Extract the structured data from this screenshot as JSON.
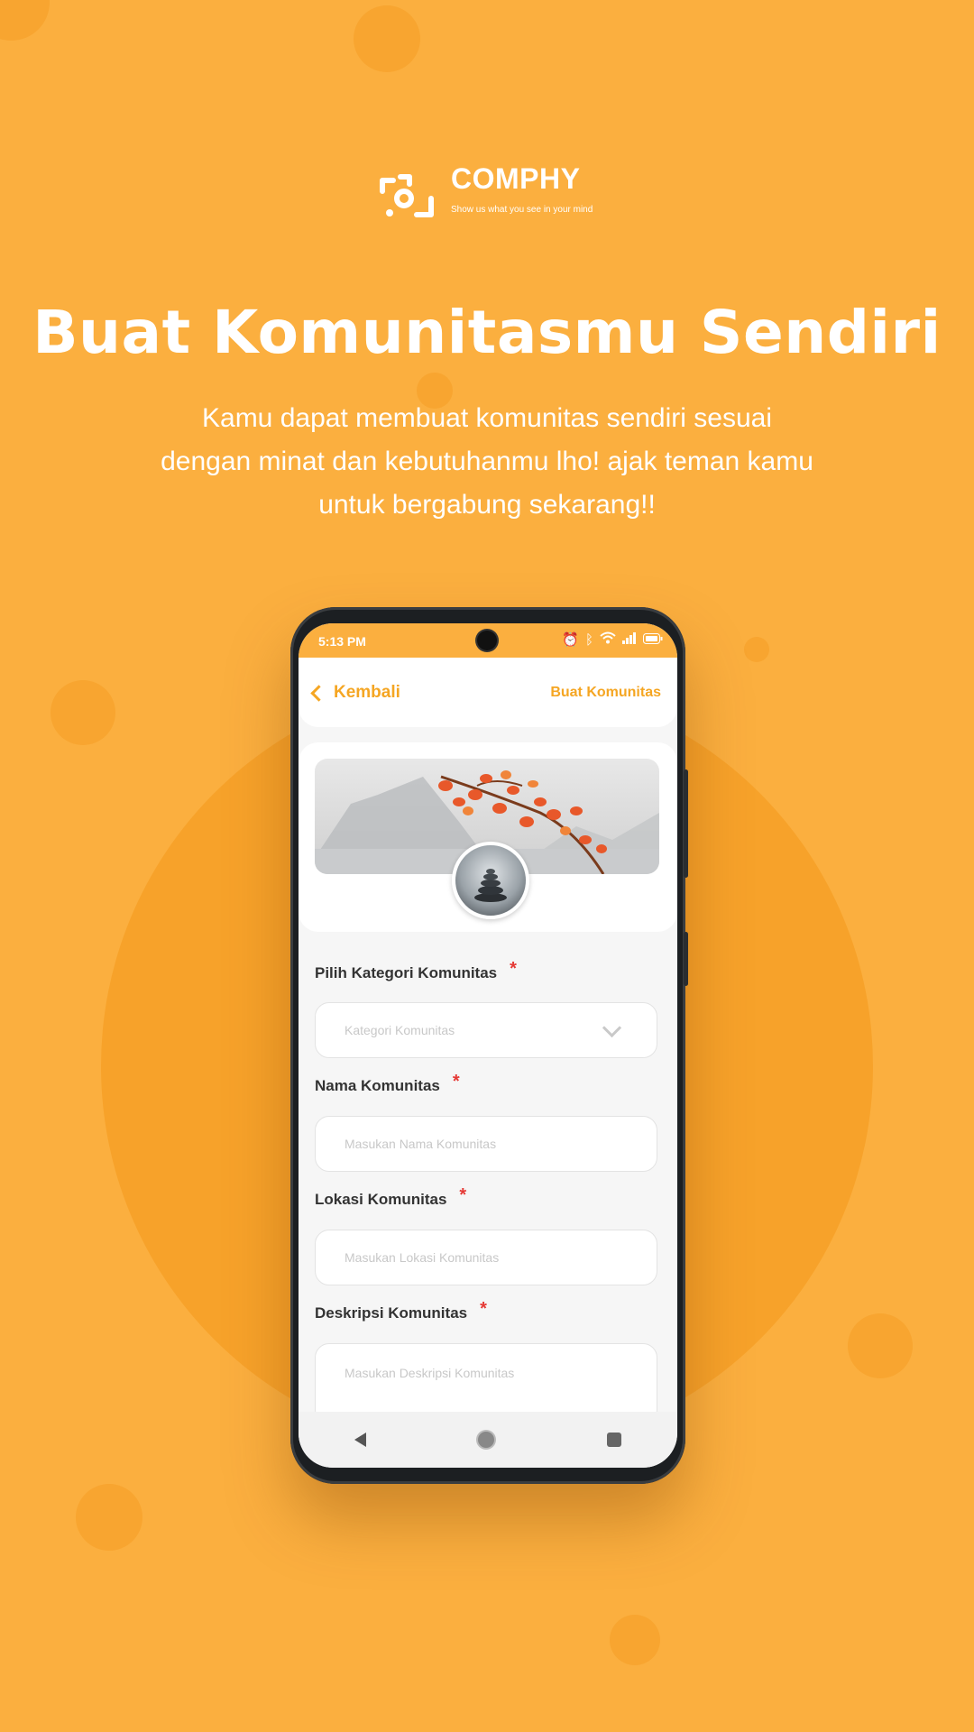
{
  "brand": {
    "name": "COMPHY",
    "tagline": "Show us what you see in your mind"
  },
  "hero": {
    "title": "Buat Komunitasmu Sendiri",
    "subtitle": "Kamu dapat membuat komunitas sendiri sesuai dengan minat dan kebutuhanmu lho! ajak teman kamu untuk bergabung sekarang!!"
  },
  "phone": {
    "status_time": "5:13 PM",
    "status_icons": [
      "alarm-icon",
      "bluetooth-icon",
      "wifi-icon",
      "signal-icon",
      "battery-icon"
    ],
    "back_label": "Kembali",
    "page_title": "Buat Komunitas",
    "form": {
      "category": {
        "label": "Pilih Kategori Komunitas",
        "placeholder": "Kategori Komunitas",
        "required": "*"
      },
      "name": {
        "label": "Nama Komunitas",
        "placeholder": "Masukan Nama Komunitas",
        "required": "*"
      },
      "location": {
        "label": "Lokasi Komunitas",
        "placeholder": "Masukan Lokasi Komunitas",
        "required": "*"
      },
      "description": {
        "label": "Deskripsi Komunitas",
        "placeholder": "Masukan Deskripsi Komunitas",
        "required": "*"
      }
    }
  },
  "colors": {
    "background": "#fbaf3f",
    "accent": "#f5a623",
    "required": "#e53935"
  }
}
